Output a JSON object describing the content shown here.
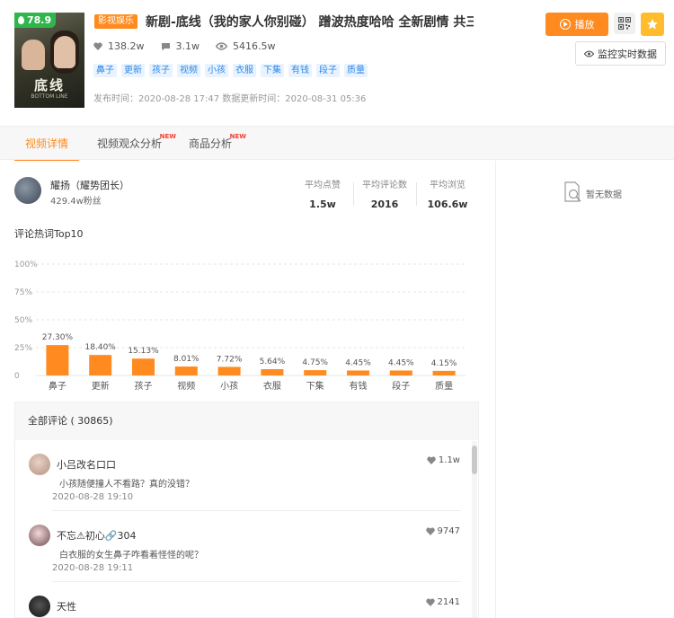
{
  "video": {
    "score": "78.9",
    "category": "影视娱乐",
    "title": "新剧-底线（我的家人你别碰） 蹭波热度哈哈  全新剧情 共三集 @…",
    "cover_title": "底线",
    "cover_subtitle": "BOTTOM LINE",
    "stats": {
      "likes": "138.2w",
      "comments": "3.1w",
      "views": "5416.5w"
    },
    "tags": [
      "鼻子",
      "更新",
      "孩子",
      "视频",
      "小孩",
      "衣服",
      "下集",
      "有钱",
      "段子",
      "质量"
    ],
    "times": "发布时间：2020-08-28 17:47  数据更新时间：2020-08-31 05:36"
  },
  "actions": {
    "play_label": "播放",
    "monitor_label": "监控实时数据"
  },
  "tabs": [
    {
      "label": "视频详情",
      "active": true,
      "new": ""
    },
    {
      "label": "视频观众分析",
      "active": false,
      "new": "NEW"
    },
    {
      "label": "商品分析",
      "active": false,
      "new": "NEW"
    }
  ],
  "author": {
    "name": "耀扬（耀势团长）",
    "fans": "429.4w粉丝"
  },
  "averages": [
    {
      "label": "平均点赞",
      "value": "1.5w"
    },
    {
      "label": "平均评论数",
      "value": "2016"
    },
    {
      "label": "平均浏览",
      "value": "106.6w"
    }
  ],
  "chart_title": "评论热词Top10",
  "chart_data": {
    "type": "bar",
    "categories": [
      "鼻子",
      "更新",
      "孩子",
      "视频",
      "小孩",
      "衣服",
      "下集",
      "有钱",
      "段子",
      "质量"
    ],
    "values": [
      27.3,
      18.4,
      15.13,
      8.01,
      7.72,
      5.64,
      4.75,
      4.45,
      4.45,
      4.15
    ],
    "value_labels": [
      "27.30%",
      "18.40%",
      "15.13%",
      "8.01%",
      "7.72%",
      "5.64%",
      "4.75%",
      "4.45%",
      "4.45%",
      "4.15%"
    ],
    "yticks": [
      "0",
      "25%",
      "50%",
      "75%",
      "100%"
    ],
    "ylim": [
      0,
      100
    ],
    "grid": true,
    "color": "#ff8a1f"
  },
  "comments": {
    "header": "全部评论 ( 30865)",
    "items": [
      {
        "user": "小吕改名口口",
        "text": "小孩随便撞人不看路？真的没错？",
        "date": "2020-08-28 19:10",
        "likes": "1.1w"
      },
      {
        "user": "不忘⚠初心🔗304",
        "text": "白衣服的女生鼻子咋看着怪怪的呢？",
        "date": "2020-08-28 19:11",
        "likes": "9747"
      },
      {
        "user": "天性",
        "text": "",
        "date": "",
        "likes": "2141"
      }
    ]
  },
  "nodata_label": "暂无数据"
}
